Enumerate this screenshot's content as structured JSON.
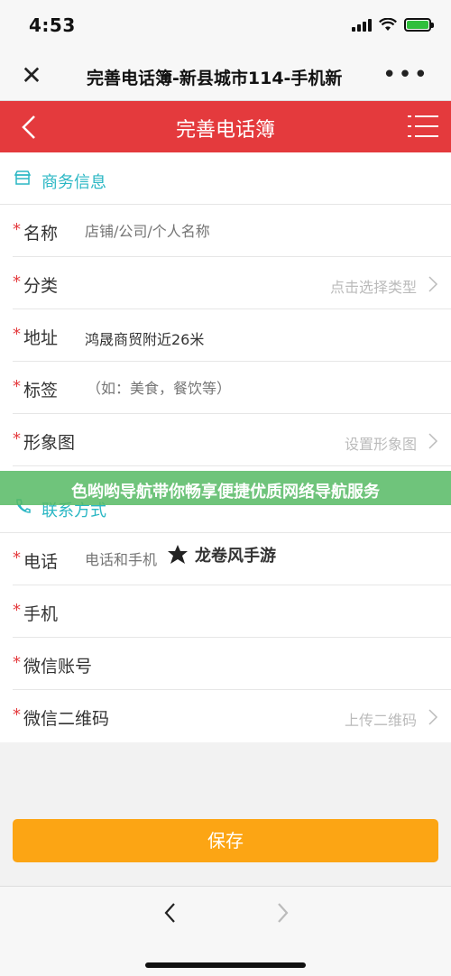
{
  "status_bar": {
    "time": "4:53"
  },
  "browser": {
    "close_label": "✕",
    "title": "完善电话簿-新县城市114-手机新",
    "more_label": "•••"
  },
  "header": {
    "title": "完善电话簿"
  },
  "business_section": {
    "title": "商务信息"
  },
  "business_fields": {
    "name": {
      "required": "*",
      "label": "名称",
      "placeholder": "店铺/公司/个人名称"
    },
    "category": {
      "required": "*",
      "label": "分类",
      "value": "点击选择类型"
    },
    "address": {
      "required": "*",
      "label": "地址",
      "value": "鸿晟商贸附近26米"
    },
    "tags": {
      "required": "*",
      "label": "标签",
      "placeholder": "（如：美食，餐饮等）"
    },
    "image": {
      "required": "*",
      "label": "形象图",
      "value": "设置形象图"
    }
  },
  "contact_section": {
    "title": "联系方式"
  },
  "contact_fields": {
    "phone": {
      "required": "*",
      "label": "电话",
      "placeholder": "电话和手机"
    },
    "mobile": {
      "required": "*",
      "label": "手机"
    },
    "wechat": {
      "required": "*",
      "label": "微信账号"
    },
    "wechat_qr": {
      "required": "*",
      "label": "微信二维码",
      "value": "上传二维码"
    }
  },
  "banner": {
    "text": "色哟哟导航带你畅享便捷优质网络导航服务"
  },
  "watermark": {
    "text": "龙卷风手游"
  },
  "actions": {
    "save_label": "保存"
  },
  "colors": {
    "header": "#e43a3d",
    "accent": "#2bb7c4",
    "save": "#fca514",
    "required": "#e43a3d"
  }
}
